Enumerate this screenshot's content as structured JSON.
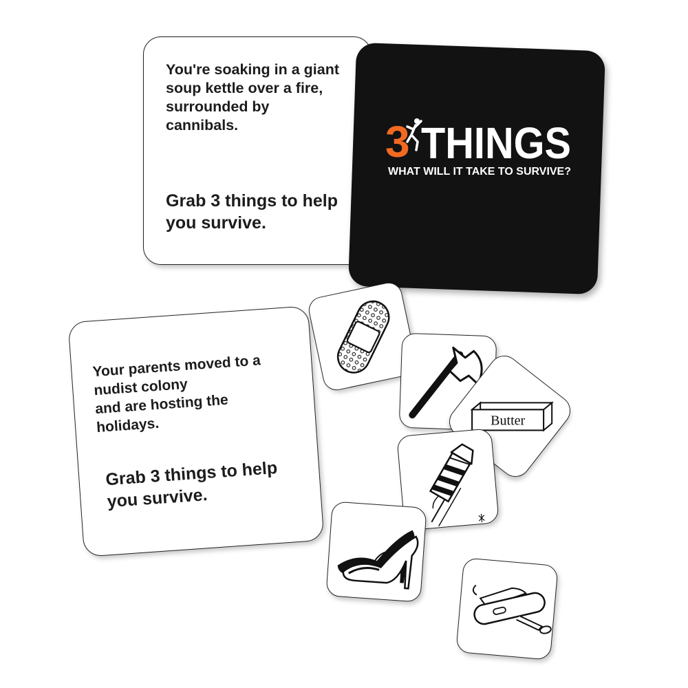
{
  "scenario_cards": [
    {
      "prompt": "You're soaking in a giant\nsoup kettle over a fire,\nsurrounded by\ncannibals.",
      "action": "Grab 3 things to help\nyou survive."
    },
    {
      "prompt": "Your parents moved to a\nnudist colony\nand are hosting the\nholidays.",
      "action": "Grab 3 things to help\nyou survive."
    }
  ],
  "title_card": {
    "logo_number": "3",
    "logo_word": "THINGS",
    "tagline": "WHAT WILL IT TAKE TO SURVIVE?",
    "colors": {
      "background": "#121212",
      "number": "#f26a21",
      "text": "#ffffff"
    }
  },
  "item_cards": [
    {
      "icon": "bandage-icon"
    },
    {
      "icon": "axe-icon"
    },
    {
      "icon": "butter-icon",
      "label": "Butter"
    },
    {
      "icon": "firework-rocket-icon"
    },
    {
      "icon": "high-heels-icon"
    },
    {
      "icon": "pocket-knife-icon"
    }
  ]
}
